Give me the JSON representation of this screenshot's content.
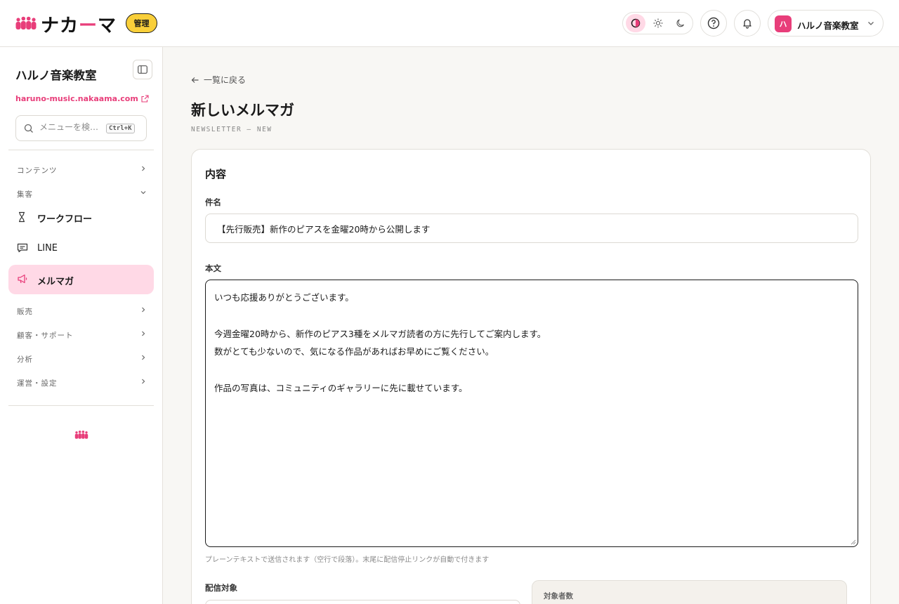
{
  "header": {
    "brand": "ナカーマ",
    "brand_parts": [
      "ナカ",
      "ー",
      "マ"
    ],
    "admin_badge": "管理",
    "account_initial": "ハ",
    "account_name": "ハルノ音楽教室",
    "accent_color": "#e83e7a",
    "badge_color": "#f9cf3a"
  },
  "sidebar": {
    "site_name": "ハルノ音楽教室",
    "site_url": "haruno-music.nakaama.com",
    "search_placeholder": "メニューを検…",
    "search_shortcut": "Ctrl+K",
    "groups": {
      "content": "コンテンツ",
      "marketing": "集客",
      "sales": "販売",
      "support": "顧客・サポート",
      "analytics": "分析",
      "settings": "運営・設定"
    },
    "items": {
      "workflow": "ワークフロー",
      "line": "LINE",
      "newsletter": "メルマガ"
    }
  },
  "main": {
    "back_label": "一覧に戻る",
    "title": "新しいメルマガ",
    "subtitle": "NEWSLETTER — NEW",
    "section_title": "内容",
    "subject_label": "件名",
    "subject_value": "【先行販売】新作のピアスを金曜20時から公開します",
    "body_label": "本文",
    "body_value": "いつも応援ありがとうございます。\n\n今週金曜20時から、新作のピアス3種をメルマガ読者の方に先行してご案内します。\n数がとても少ないので、気になる作品があればお早めにご覧ください。\n\n作品の写真は、コミュニティのギャラリーに先に載せています。",
    "body_hint": "プレーンテキストで送信されます（空行で段落）。末尾に配信停止リンクが自動で付きます",
    "target_label": "配信対象",
    "count_label": "対象者数"
  }
}
